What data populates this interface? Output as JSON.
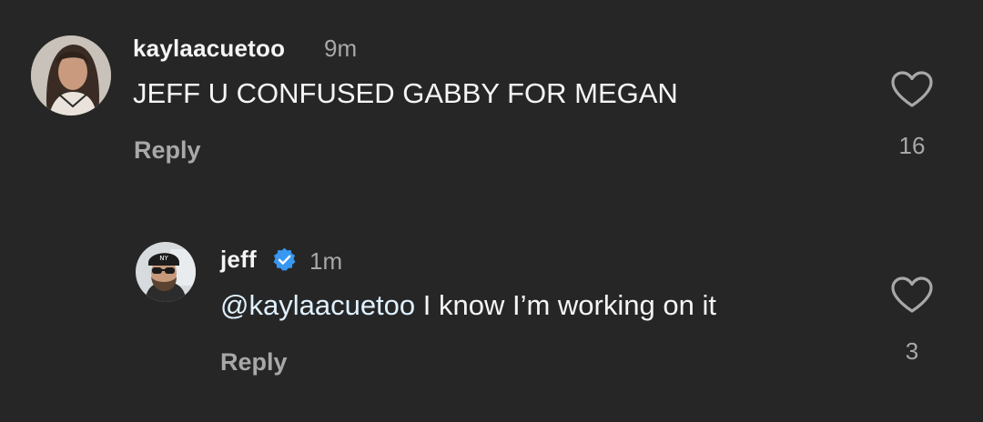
{
  "comments": [
    {
      "username": "kaylaacuetoo",
      "time": "9m",
      "text": "JEFF U CONFUSED GABBY FOR MEGAN",
      "reply_label": "Reply",
      "likes": "16",
      "avatar_icon": "user-avatar-photo"
    },
    {
      "username": "jeff",
      "verified": true,
      "verified_icon": "verified-badge-icon",
      "time": "1m",
      "mention": "@kaylaacuetoo",
      "text": " I know I’m working on it",
      "reply_label": "Reply",
      "likes": "3",
      "avatar_icon": "user-avatar-photo"
    }
  ],
  "colors": {
    "background": "#262626",
    "primary_text": "#f5f5f5",
    "secondary_text": "#a8a8a8",
    "verified_blue": "#3897f0",
    "mention": "#e0f1ff"
  }
}
